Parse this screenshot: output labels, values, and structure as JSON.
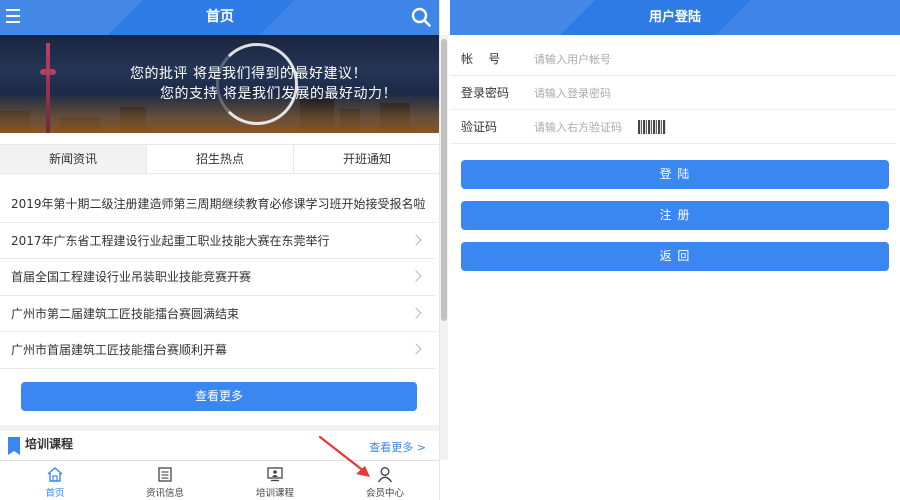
{
  "home": {
    "title": "首页",
    "banner": {
      "line1": "您的批评  将是我们得到的最好建议！",
      "line2": "您的支持  将是我们发展的最好动力！"
    },
    "tabs": [
      {
        "label": "新闻资讯",
        "active": true
      },
      {
        "label": "招生热点",
        "active": false
      },
      {
        "label": "开班通知",
        "active": false
      }
    ],
    "news": [
      "2019年第十期二级注册建造师第三周期继续教育必修课学习班开始接受报名啦",
      "2017年广东省工程建设行业起重工职业技能大赛在东莞举行",
      "首届全国工程建设行业吊装职业技能竞赛开赛",
      "广州市第二届建筑工匠技能擂台赛圆满结束",
      "广州市首届建筑工匠技能擂台赛顺利开幕"
    ],
    "more_button": "查看更多",
    "section": {
      "title": "培训课程",
      "more": "查看更多 >"
    },
    "tabbar": [
      {
        "label": "首页",
        "icon": "home-icon",
        "active": true
      },
      {
        "label": "资讯信息",
        "icon": "news-icon",
        "active": false
      },
      {
        "label": "培训课程",
        "icon": "course-icon",
        "active": false
      },
      {
        "label": "会员中心",
        "icon": "user-icon",
        "active": false
      }
    ],
    "accent": "#3a87f2",
    "arrow_color": "#e53935"
  },
  "login": {
    "title": "用户登陆",
    "fields": [
      {
        "label": "帐    号",
        "placeholder": "请输入用户帐号"
      },
      {
        "label": "登录密码",
        "placeholder": "请输入登录密码"
      },
      {
        "label": "验证码",
        "placeholder": "请输入右方验证码"
      }
    ],
    "buttons": {
      "login": "登    陆",
      "register": "注    册",
      "back": "返    回"
    }
  }
}
